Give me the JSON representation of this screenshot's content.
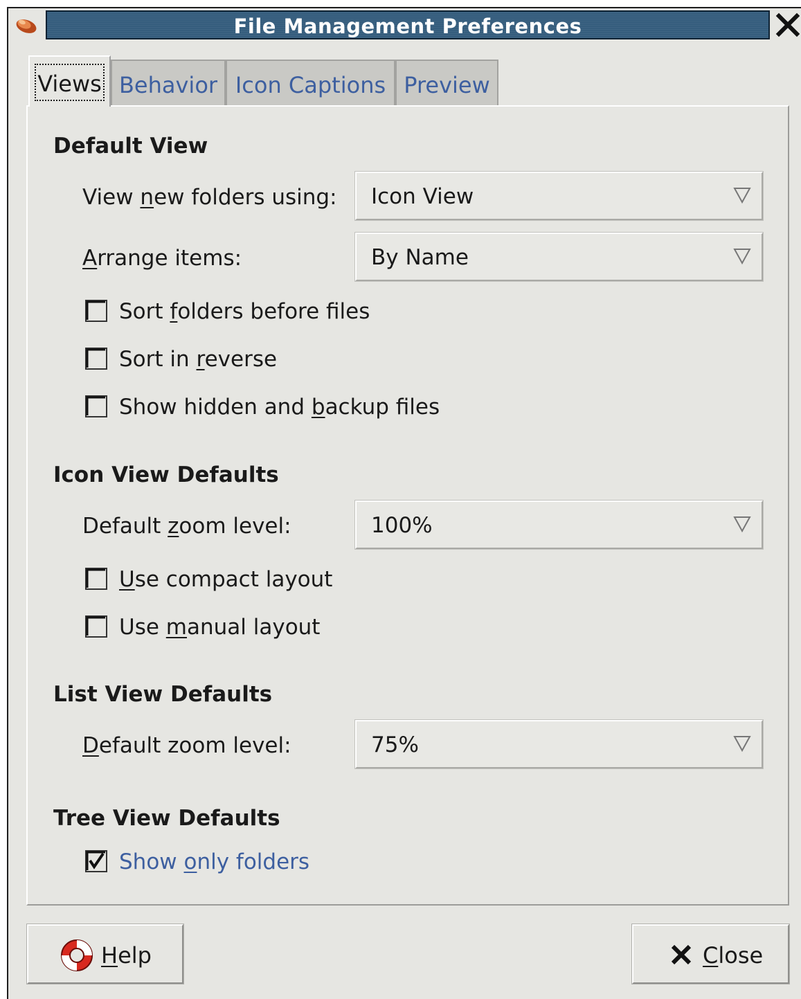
{
  "window": {
    "title": "File Management Preferences"
  },
  "tabs": [
    {
      "label": "Views",
      "active": true
    },
    {
      "label": "Behavior",
      "active": false
    },
    {
      "label": "Icon Captions",
      "active": false
    },
    {
      "label": "Preview",
      "active": false
    }
  ],
  "default_view": {
    "title": "Default View",
    "view_new_folders": {
      "pre": "View ",
      "mn": "n",
      "post": "ew folders using:",
      "value": "Icon View"
    },
    "arrange_items": {
      "pre": "",
      "mn": "A",
      "post": "rrange items:",
      "value": "By Name"
    },
    "checks": [
      {
        "pre": "Sort ",
        "mn": "f",
        "post": "olders before files",
        "checked": false
      },
      {
        "pre": "Sort in ",
        "mn": "r",
        "post": "everse",
        "checked": false
      },
      {
        "pre": "Show hidden and ",
        "mn": "b",
        "post": "ackup files",
        "checked": false
      }
    ]
  },
  "icon_view": {
    "title": "Icon View Defaults",
    "zoom": {
      "pre": "Default ",
      "mn": "z",
      "post": "oom level:",
      "value": "100%"
    },
    "checks": [
      {
        "pre": "",
        "mn": "U",
        "post": "se compact layout",
        "checked": false
      },
      {
        "pre": "Use ",
        "mn": "m",
        "post": "anual layout",
        "checked": false
      }
    ]
  },
  "list_view": {
    "title": "List View Defaults",
    "zoom": {
      "pre": "",
      "mn": "D",
      "post": "efault zoom level:",
      "value": "75%"
    }
  },
  "tree_view": {
    "title": "Tree View Defaults",
    "checks": [
      {
        "pre": "Show ",
        "mn": "o",
        "post": "nly folders",
        "checked": true
      }
    ]
  },
  "buttons": {
    "help": {
      "pre": "",
      "mn": "H",
      "post": "elp"
    },
    "close": {
      "pre": "",
      "mn": "C",
      "post": "lose"
    }
  },
  "icons": {
    "app": "file-manager-icon",
    "window_close": "close-icon",
    "combo_arrow": "triangle-down-icon",
    "help": "lifebuoy-icon",
    "close": "close-x-icon"
  },
  "colors": {
    "titlebar": "#355d7d",
    "tab_text": "#3d5fa0",
    "background": "#e6e6e2"
  }
}
